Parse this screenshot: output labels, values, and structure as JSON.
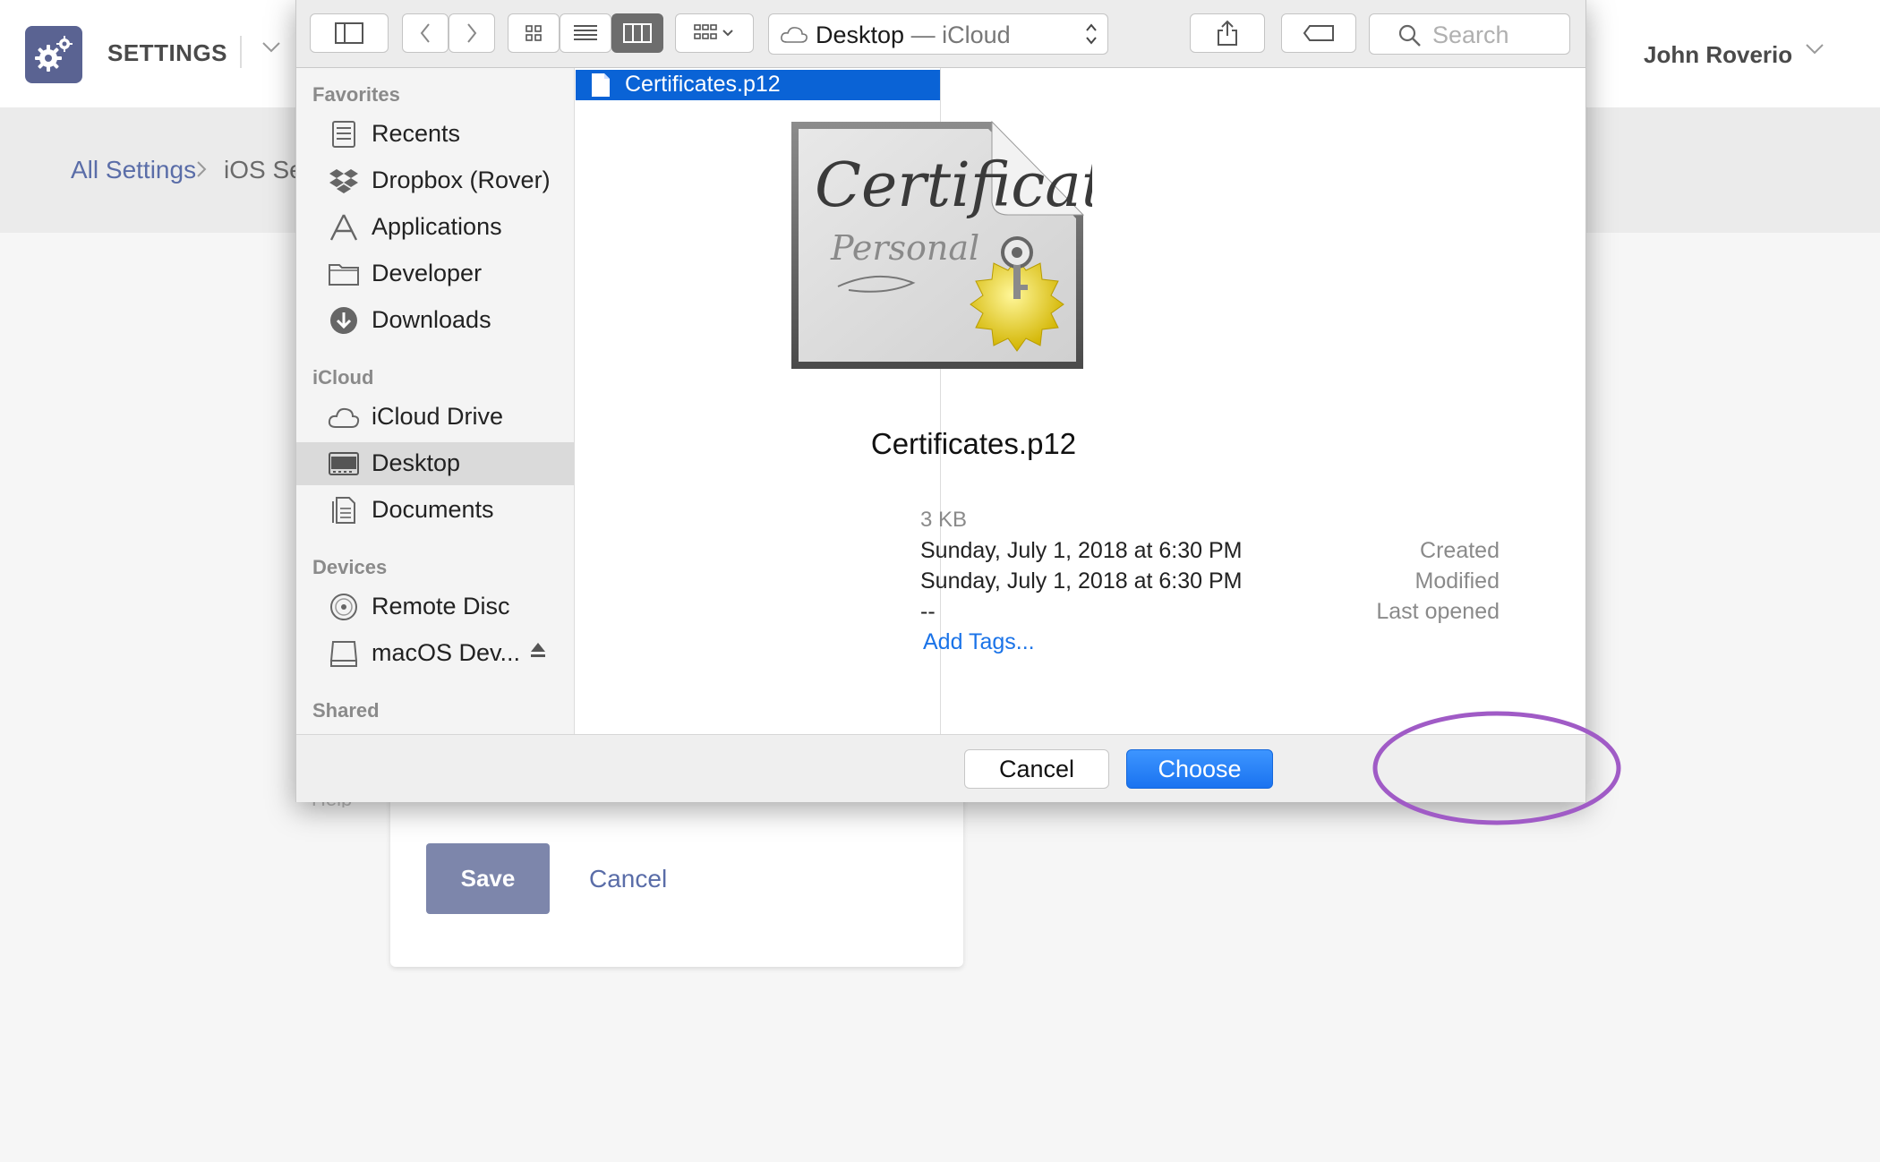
{
  "app": {
    "title": "SETTINGS",
    "user_name": "John Roverio"
  },
  "breadcrumb": {
    "root": "All Settings",
    "current": "iOS Settings"
  },
  "form": {
    "help_text": "Help",
    "save_label": "Save",
    "cancel_label": "Cancel"
  },
  "dialog": {
    "location": {
      "folder": "Desktop",
      "separator": " — ",
      "source": "iCloud"
    },
    "search_placeholder": "Search",
    "sidebar": {
      "favorites_heading": "Favorites",
      "favorites": [
        {
          "label": "Recents",
          "icon": "recents-icon"
        },
        {
          "label": "Dropbox (Rover)",
          "icon": "dropbox-icon"
        },
        {
          "label": "Applications",
          "icon": "applications-icon"
        },
        {
          "label": "Developer",
          "icon": "folder-icon"
        },
        {
          "label": "Downloads",
          "icon": "downloads-icon"
        }
      ],
      "icloud_heading": "iCloud",
      "icloud": [
        {
          "label": "iCloud Drive",
          "icon": "cloud-icon"
        },
        {
          "label": "Desktop",
          "icon": "desktop-icon",
          "selected": true
        },
        {
          "label": "Documents",
          "icon": "documents-icon"
        }
      ],
      "devices_heading": "Devices",
      "devices": [
        {
          "label": "Remote Disc",
          "icon": "disc-icon"
        },
        {
          "label": "macOS Dev...",
          "icon": "drive-icon"
        }
      ],
      "shared_heading": "Shared"
    },
    "files": [
      {
        "name": "Certificates.p12",
        "selected": true
      }
    ],
    "preview": {
      "name": "Certificates.p12",
      "size": "3 KB",
      "created_label": "Created",
      "created_value": "Sunday, July 1, 2018 at 6:30 PM",
      "modified_label": "Modified",
      "modified_value": "Sunday, July 1, 2018 at 6:30 PM",
      "last_opened_label": "Last opened",
      "last_opened_value": "--",
      "add_tags": "Add Tags..."
    },
    "buttons": {
      "cancel": "Cancel",
      "choose": "Choose"
    }
  },
  "colors": {
    "accent_blue": "#1a73f0",
    "brand": "#5a6392",
    "highlight_ring": "#a05bc6"
  }
}
